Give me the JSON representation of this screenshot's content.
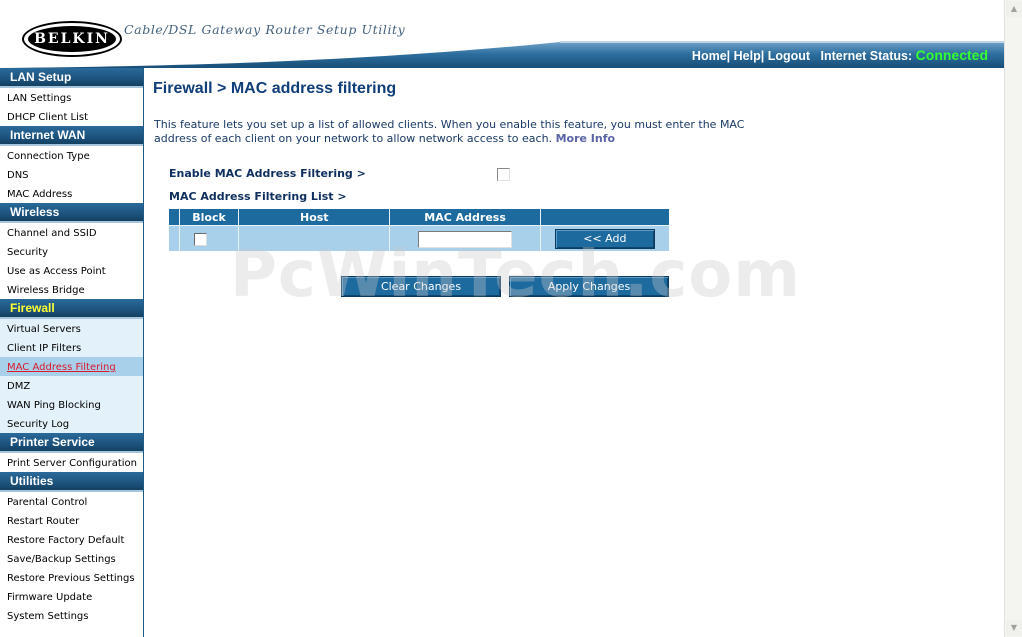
{
  "header": {
    "logo_text": "BELKIN",
    "subtitle": "Cable/DSL Gateway Router Setup Utility",
    "links": [
      "Home",
      "Help",
      "Logout"
    ],
    "status_label": "Internet Status:",
    "status_value": "Connected"
  },
  "sidebar": {
    "sections": [
      {
        "title": "LAN Setup",
        "items": [
          "LAN Settings",
          "DHCP Client List"
        ]
      },
      {
        "title": "Internet WAN",
        "items": [
          "Connection Type",
          "DNS",
          "MAC Address"
        ]
      },
      {
        "title": "Wireless",
        "items": [
          "Channel and SSID",
          "Security",
          "Use as Access Point",
          "Wireless Bridge"
        ]
      },
      {
        "title": "Firewall",
        "items": [
          "Virtual Servers",
          "Client IP Filters",
          "MAC Address Filtering",
          "DMZ",
          "WAN Ping Blocking",
          "Security Log"
        ]
      },
      {
        "title": "Printer Service",
        "items": [
          "Print Server Configuration"
        ]
      },
      {
        "title": "Utilities",
        "items": [
          "Parental Control",
          "Restart Router",
          "Restore Factory Default",
          "Save/Backup Settings",
          "Restore Previous Settings",
          "Firmware Update",
          "System Settings"
        ]
      }
    ],
    "active_section": "Firewall",
    "active_item": "MAC Address Filtering"
  },
  "main": {
    "title": "Firewall > MAC address filtering",
    "description": "This feature lets you set up a list of allowed clients. When you enable this feature, you must enter the MAC address of each client on your network to allow network access to each.",
    "more_info": "More Info",
    "enable_label": "Enable MAC Address Filtering >",
    "enable_checked": false,
    "list_label": "MAC Address Filtering List >",
    "table": {
      "headers": [
        "",
        "Block",
        "Host",
        "MAC Address",
        ""
      ],
      "row": {
        "block_checked": false,
        "host": "",
        "mac_value": "",
        "add_label": "<< Add"
      }
    },
    "buttons": {
      "clear": "Clear Changes",
      "apply": "Apply Changes"
    }
  },
  "watermark": "PcWinTech.com",
  "colors": {
    "nav_header": "#1b4f79",
    "accent_blue": "#1d6a9f",
    "row_light": "#a9d0ea",
    "status_green": "#33ff33",
    "active_link": "#d8182b"
  }
}
